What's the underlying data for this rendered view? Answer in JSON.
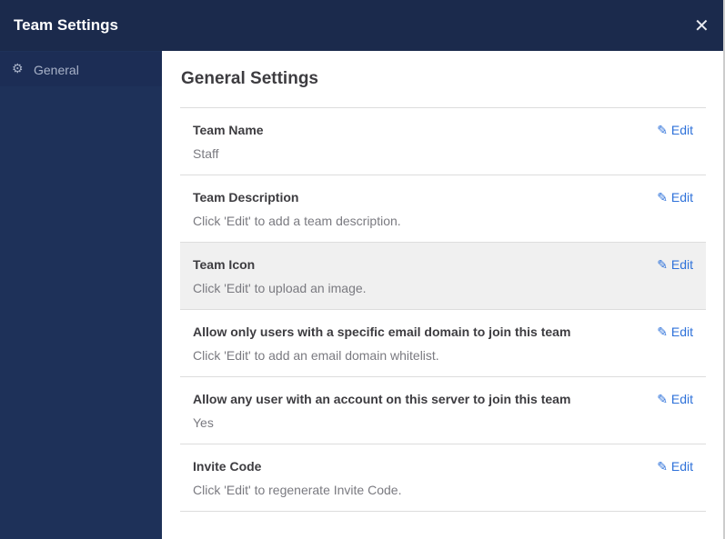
{
  "header": {
    "title": "Team Settings",
    "close_icon": "close-icon"
  },
  "sidebar": {
    "items": [
      {
        "label": "General",
        "icon": "gear-icon"
      }
    ]
  },
  "main": {
    "title": "General Settings",
    "edit_label": "Edit",
    "rows": [
      {
        "title": "Team Name",
        "value": "Staff"
      },
      {
        "title": "Team Description",
        "value": "Click 'Edit' to add a team description."
      },
      {
        "title": "Team Icon",
        "value": "Click 'Edit' to upload an image."
      },
      {
        "title": "Allow only users with a specific email domain to join this team",
        "value": "Click 'Edit' to add an email domain whitelist."
      },
      {
        "title": "Allow any user with an account on this server to join this team",
        "value": "Yes"
      },
      {
        "title": "Invite Code",
        "value": "Click 'Edit' to regenerate Invite Code."
      }
    ]
  }
}
